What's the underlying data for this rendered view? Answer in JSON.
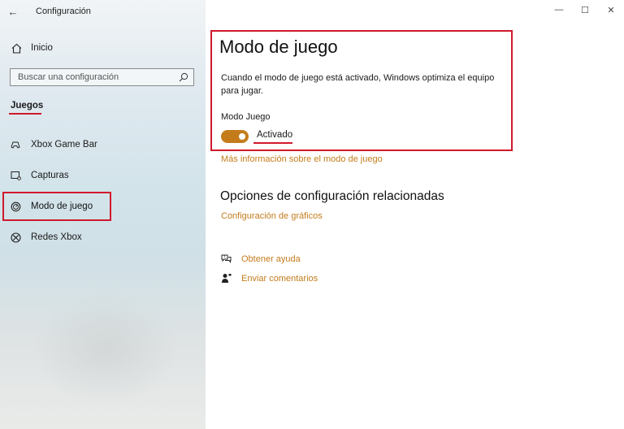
{
  "window": {
    "title": "Configuración"
  },
  "window_controls": {
    "minimize": "—",
    "maximize": "☐",
    "close": "✕"
  },
  "sidebar": {
    "back_icon": "←",
    "home_label": "Inicio",
    "search_placeholder": "Buscar una configuración",
    "section_title": "Juegos",
    "items": [
      {
        "label": "Xbox Game Bar",
        "icon": "xbox-game-bar-icon"
      },
      {
        "label": "Capturas",
        "icon": "capture-icon"
      },
      {
        "label": "Modo de juego",
        "icon": "game-mode-icon",
        "selected": true
      },
      {
        "label": "Redes Xbox",
        "icon": "xbox-icon"
      }
    ]
  },
  "main": {
    "title": "Modo de juego",
    "description": "Cuando el modo de juego está activado, Windows optimiza el equipo para jugar.",
    "toggle_label": "Modo Juego",
    "toggle_state": "Activado",
    "toggle_on": true,
    "more_info_link": "Más información sobre el modo de juego",
    "related_title": "Opciones de configuración relacionadas",
    "graphics_link": "Configuración de gráficos",
    "help_link": "Obtener ayuda",
    "feedback_link": "Enviar comentarios"
  },
  "colors": {
    "accent": "#c47c1b",
    "highlight": "#d0192d"
  }
}
